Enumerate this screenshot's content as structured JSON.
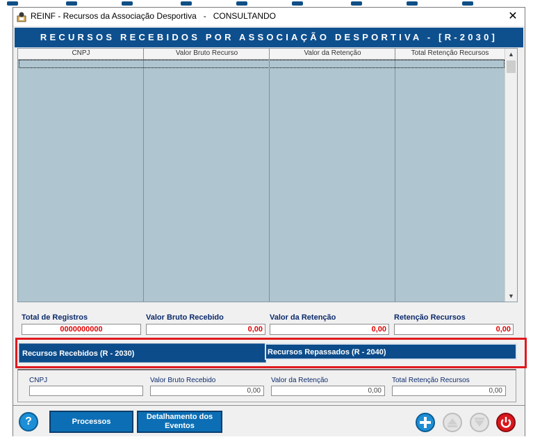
{
  "window": {
    "title": "REINF - Recursos da Associação Desportiva   -   CONSULTANDO",
    "close_icon": "close-icon"
  },
  "header": {
    "title": "RECURSOS RECEBIDOS POR ASSOCIAÇÃO DESPORTIVA - [R-2030]"
  },
  "grid": {
    "columns": [
      "CNPJ",
      "Valor Bruto Recurso",
      "Valor da Retenção",
      "Total Retenção Recursos"
    ],
    "rows": []
  },
  "totals": {
    "registros_label": "Total de Registros",
    "registros_value": "0000000000",
    "bruto_label": "Valor Bruto Recebido",
    "bruto_value": "0,00",
    "retencao_label": "Valor da Retenção",
    "retencao_value": "0,00",
    "recursos_label": "Retenção Recursos",
    "recursos_value": "0,00"
  },
  "tabs": {
    "recebidos": "Recursos Recebidos (R - 2030)",
    "repassados": "Recursos Repassados (R - 2040)"
  },
  "detail": {
    "cnpj_label": "CNPJ",
    "cnpj_value": "",
    "bruto_label": "Valor Bruto Recebido",
    "bruto_value": "0,00",
    "retencao_label": "Valor da Retenção",
    "retencao_value": "0,00",
    "total_label": "Total Retenção Recursos",
    "total_value": "0,00"
  },
  "buttons": {
    "processos": "Processos",
    "detalhamento": "Detalhamento dos Eventos"
  },
  "colors": {
    "header_blue": "#0e4f8e",
    "grid_bg": "#afc5cf",
    "totals_red": "#e00000",
    "highlight_red": "#e0191e"
  }
}
